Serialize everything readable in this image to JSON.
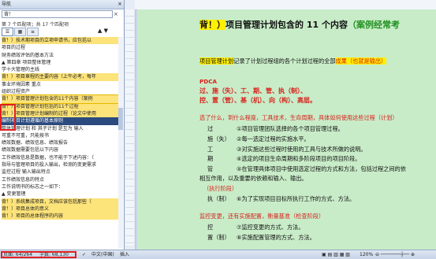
{
  "nav": {
    "title": "导航",
    "close": "×",
    "search_value": "背！",
    "search_clear": "×",
    "match_text": "第 7 个匹配项；共 17 个匹配项",
    "items": [
      "背！）技术期项目的立项申请书，应包括以",
      "项目的过程",
      "财务绩效评估的基本方法",
      "▲ 第四章 项目整体管理",
      "学十大管理的主线",
      "背！）项目章程的主要内容（上午必考，每年",
      "事业环境因素 重点",
      "组织过程资产",
      "背！）项目管理计划包含的11个内容（案例",
      "背！）项目管理计划包括的11个过程",
      "背！）项目管理计划编制的过程（论文中使用",
      "编制项目计划遵循的基本原则",
      "整体管理计划 和 其子计划 是互为 输入",
      "可重不可重，只能按书",
      "绩效数据、绩效信息、绩效报告",
      "绩效数据需要包括以下内容",
      "工作绩效信息是数据，也不能于下述内容：（",
      "指导与管理项目的投入输出，检测的变更需求",
      "监控过程 输入输出特点",
      "工作绩效信息的特点",
      "工作说明书的标志之一如下：",
      "▲ 变更管理",
      "背！）系统集成项目，文档应该包括那些（",
      "背！）项目总体的意义",
      "背！）项目的总体程序的内容"
    ]
  },
  "ruler_labels": "8 6 4 2 | 2 4 6 8 10 12 14 16 18 20 22 24 26 28 30 32 34",
  "doc": {
    "title_prefix": "背！）",
    "title_main": "项目管理计划包含的 11 个内容",
    "title_suffix": "（案例经常考",
    "line1_a": "项目管理计划",
    "line1_b": "记录了计划过程组的各个计划过程的全部",
    "line1_c": "成果（也就是输出）",
    "pdca": "PDCA",
    "pdca_1": "过、施（失）、工、期、管、执（制）、",
    "pdca_2": "控、置（管）、基（机）、向（构）、高层。",
    "sec1": "选了什么，到什么程度，工具技术，生命周期，具体如何使用这些过程（计划）",
    "r1_k": "过",
    "r1_v": "①项目管理团队选择的各个项目管理过程。",
    "r2_k": "施（失）",
    "r2_v": "②每一选定过程的实施水平。",
    "r3_k": "工",
    "r3_v": "③对实施这些过程时使用的工具与技术所做的说明。",
    "r4_k": "期",
    "r4_v": "④选定的项目生命周期和多阶段项目的项目阶段。",
    "r5_k": "管",
    "r5_v": "⑤在管理具体项目中使用选定过程的方式和方法，包括过程之间的依",
    "r5_cont": "相互作用，以及重要的依赖和输入、输出。",
    "exec": "（执行阶段）",
    "r6_k": "执（制）",
    "r6_v": "⑥为了实现项目目标所执行工作的方式、方法。",
    "sec2": "监控变更，还有实施配置，衡量基准（检查阶段）",
    "r7_k": "控",
    "r7_v": "⑦监控变更的方式、方法。",
    "r8_k": "置（制）",
    "r8_v": "⑧实施配置管理的方式、方法。"
  },
  "status": {
    "page": "页面: 64/264",
    "words": "字数: 68,130",
    "lang": "中文(中国)",
    "mode": "插入",
    "zoom": "120%"
  }
}
